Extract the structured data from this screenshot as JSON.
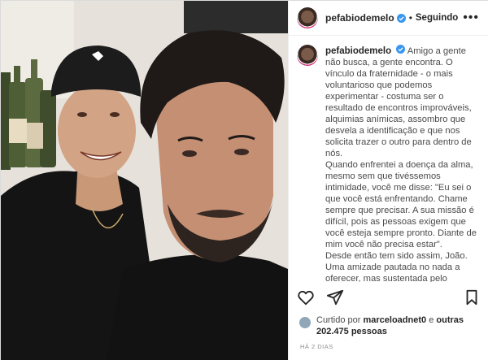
{
  "post": {
    "username": "pefabiodemelo",
    "follow_status": "Seguindo",
    "separator": "•",
    "more_label": "•••",
    "verified_icon": "verified-badge-icon",
    "caption_paragraphs": [
      "Amigo a gente não busca, a gente encontra. O vínculo da fraternidade - o mais voluntarioso que podemos experimentar - costuma ser o resultado de encontros improváveis, alquimias anímicas, assombro que desvela a identificação e que nos solicita trazer o outro para dentro de nós.",
      "Quando enfrentei a doença da alma, mesmo sem que tivéssemos intimidade, você me disse: \"Eu sei o que você está enfrentando. Chame sempre que precisar. A sua missão é difícil, pois as pessoas exigem que você esteja sempre pronto. Diante de mim você não precisa estar\".",
      "Desde então tem sido assim, João. Uma amizade pautada no nada a oferecer, mas sustentada pelo absoluto desejo de tudo perceber e celebrar."
    ],
    "actions": {
      "like_icon": "heart-icon",
      "comment_icon": "comment-icon",
      "share_icon": "share-icon",
      "save_icon": "bookmark-icon"
    },
    "likes": {
      "prefix": "Curtido por ",
      "user": "marceloadnet0",
      "middle": " e ",
      "count": "outras 202.475 pessoas"
    },
    "date": "HÁ 2 DIAS"
  },
  "colors": {
    "accent_blue": "#3897f0",
    "text": "#262626",
    "muted": "#8e8e8e"
  }
}
